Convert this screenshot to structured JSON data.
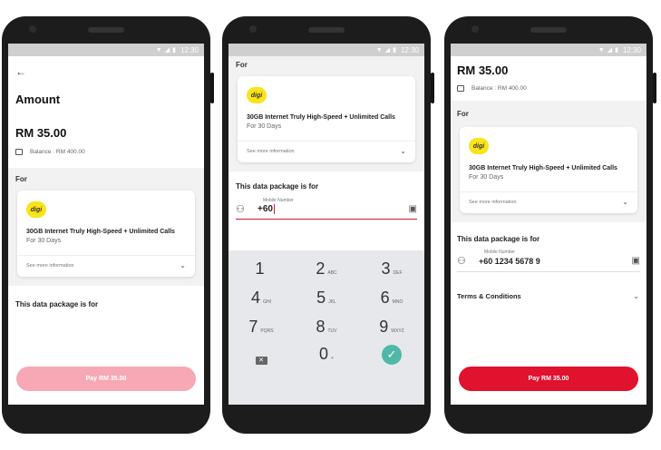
{
  "status": {
    "time": "12:30"
  },
  "screen1": {
    "back_icon": "arrow-left-icon",
    "title": "Amount",
    "amount": "RM 35.00",
    "balance": "Balance : RM 400.00",
    "for_label": "For",
    "package": {
      "logo": "digi",
      "title": "30GB Internet Truly High-Speed + Unlimited Calls",
      "duration": "For 30 Days",
      "see_more": "See more information"
    },
    "data_for_label": "This data package is for",
    "pay_button": "Pay RM 35.00"
  },
  "screen2": {
    "for_label": "For",
    "package": {
      "logo": "digi",
      "title": "30GB Internet Truly High-Speed + Unlimited Calls",
      "duration": "For 30 Days",
      "see_more": "See more information"
    },
    "data_for_label": "This data package is for",
    "mobile_label": "Mobile Number",
    "mobile_value": "+60",
    "keys": [
      {
        "n": "1",
        "l": ""
      },
      {
        "n": "2",
        "l": "ABC"
      },
      {
        "n": "3",
        "l": "DEF"
      },
      {
        "n": "4",
        "l": "GHI"
      },
      {
        "n": "5",
        "l": "JKL"
      },
      {
        "n": "6",
        "l": "MNO"
      },
      {
        "n": "7",
        "l": "PQRS"
      },
      {
        "n": "8",
        "l": "TUV"
      },
      {
        "n": "9",
        "l": "WXYZ"
      },
      {
        "n": "0",
        "l": "+"
      }
    ]
  },
  "screen3": {
    "amount": "RM 35.00",
    "balance": "Balance : RM 400.00",
    "for_label": "For",
    "package": {
      "logo": "digi",
      "title": "30GB Internet Truly High-Speed + Unlimited Calls",
      "duration": "For 30 Days",
      "see_more": "See more information"
    },
    "data_for_label": "This data package is for",
    "mobile_label": "Mobile Number",
    "mobile_value": "+60 1234 5678 9",
    "terms": "Terms & Conditions",
    "pay_button": "Pay RM 35.00"
  },
  "colors": {
    "pay_disabled": "#f6a9b5",
    "pay_active": "#e0122e",
    "check": "#4fb8a8",
    "input_underline": "#e0122e"
  }
}
